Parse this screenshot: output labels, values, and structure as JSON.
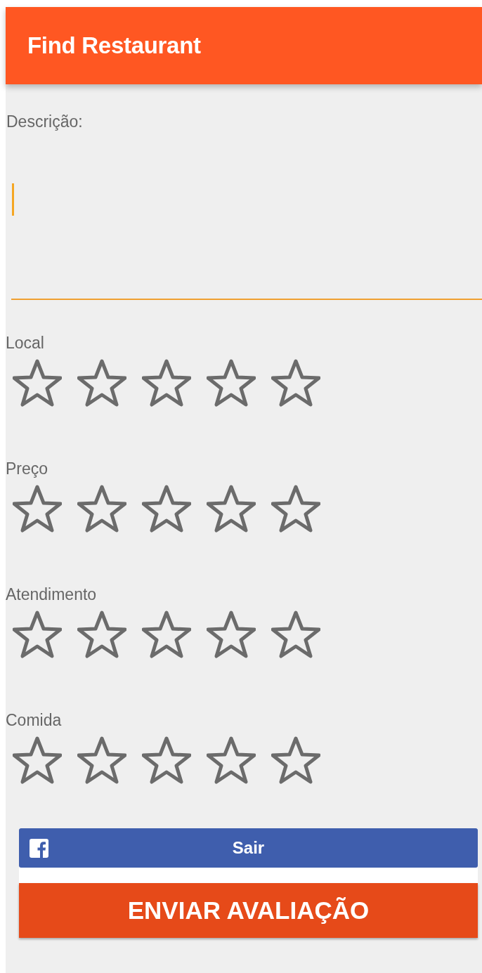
{
  "app_bar": {
    "title": "Find Restaurant"
  },
  "description": {
    "label": "Descrição:"
  },
  "ratings": [
    {
      "label": "Local",
      "stars": 0
    },
    {
      "label": "Preço",
      "stars": 0
    },
    {
      "label": "Atendimento",
      "stars": 0
    },
    {
      "label": "Comida",
      "stars": 0
    }
  ],
  "facebook_button": {
    "label": "Sair"
  },
  "submit_button": {
    "label": "ENVIAR AVALIAÇÃO"
  }
}
